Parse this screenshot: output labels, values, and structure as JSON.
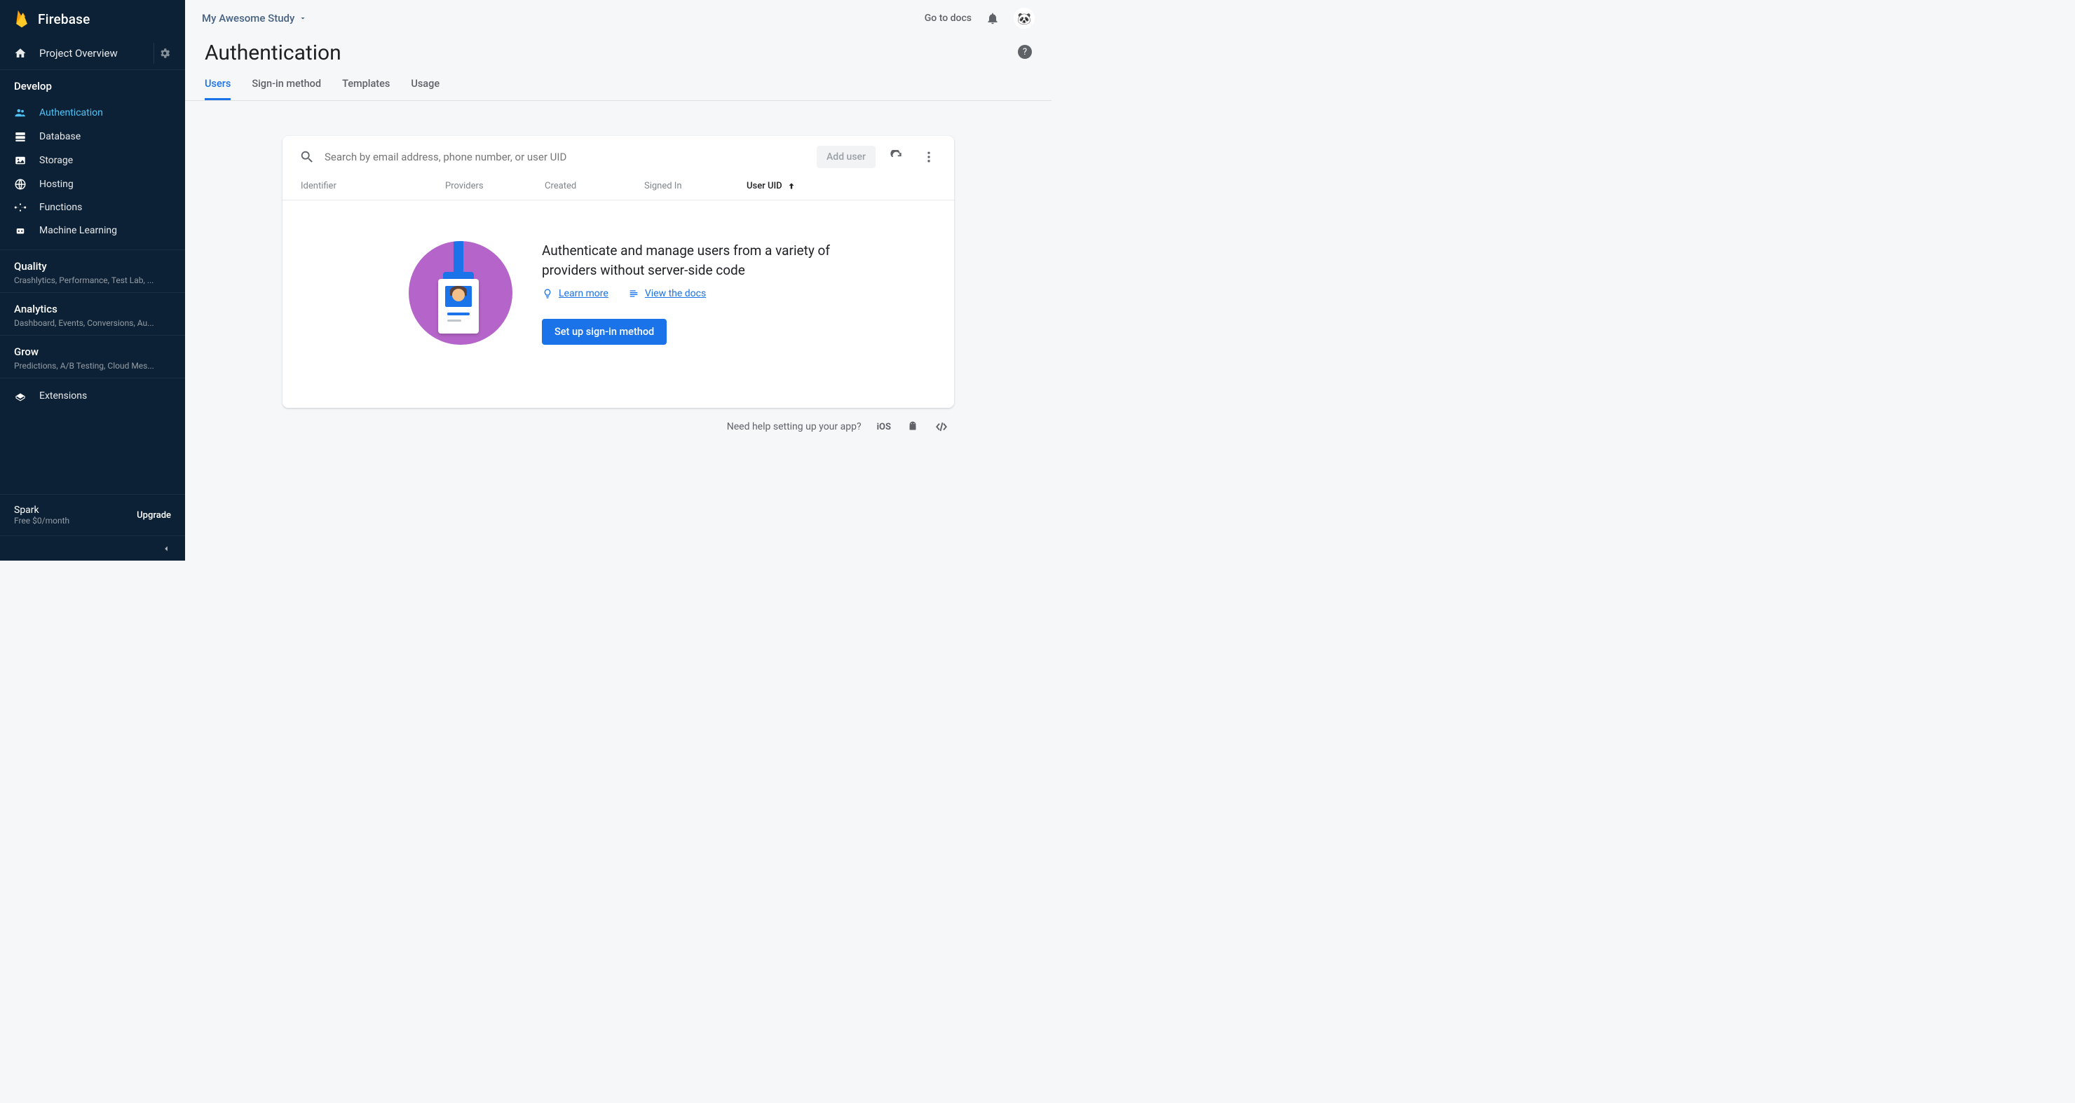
{
  "brand": "Firebase",
  "project_overview": "Project Overview",
  "sections": {
    "develop": "Develop",
    "quality": "Quality",
    "quality_sub": "Crashlytics, Performance, Test Lab, ...",
    "analytics": "Analytics",
    "analytics_sub": "Dashboard, Events, Conversions, Au...",
    "grow": "Grow",
    "grow_sub": "Predictions, A/B Testing, Cloud Mes..."
  },
  "nav": {
    "auth": "Authentication",
    "db": "Database",
    "storage": "Storage",
    "hosting": "Hosting",
    "functions": "Functions",
    "ml": "Machine Learning",
    "extensions": "Extensions"
  },
  "plan": {
    "name": "Spark",
    "price": "Free $0/month",
    "upgrade": "Upgrade"
  },
  "header": {
    "project": "My Awesome Study",
    "goto": "Go to docs"
  },
  "page": {
    "title": "Authentication"
  },
  "tabs": [
    "Users",
    "Sign-in method",
    "Templates",
    "Usage"
  ],
  "search": {
    "placeholder": "Search by email address, phone number, or user UID"
  },
  "buttons": {
    "add_user": "Add user",
    "cta": "Set up sign-in method"
  },
  "cols": {
    "id": "Identifier",
    "prov": "Providers",
    "created": "Created",
    "signed": "Signed In",
    "uid": "User UID"
  },
  "empty": {
    "heading": "Authenticate and manage users from a variety of providers without server-side code",
    "learn": "Learn more",
    "docs": "View the docs"
  },
  "help": {
    "text": "Need help setting up your app?",
    "ios": "iOS"
  }
}
